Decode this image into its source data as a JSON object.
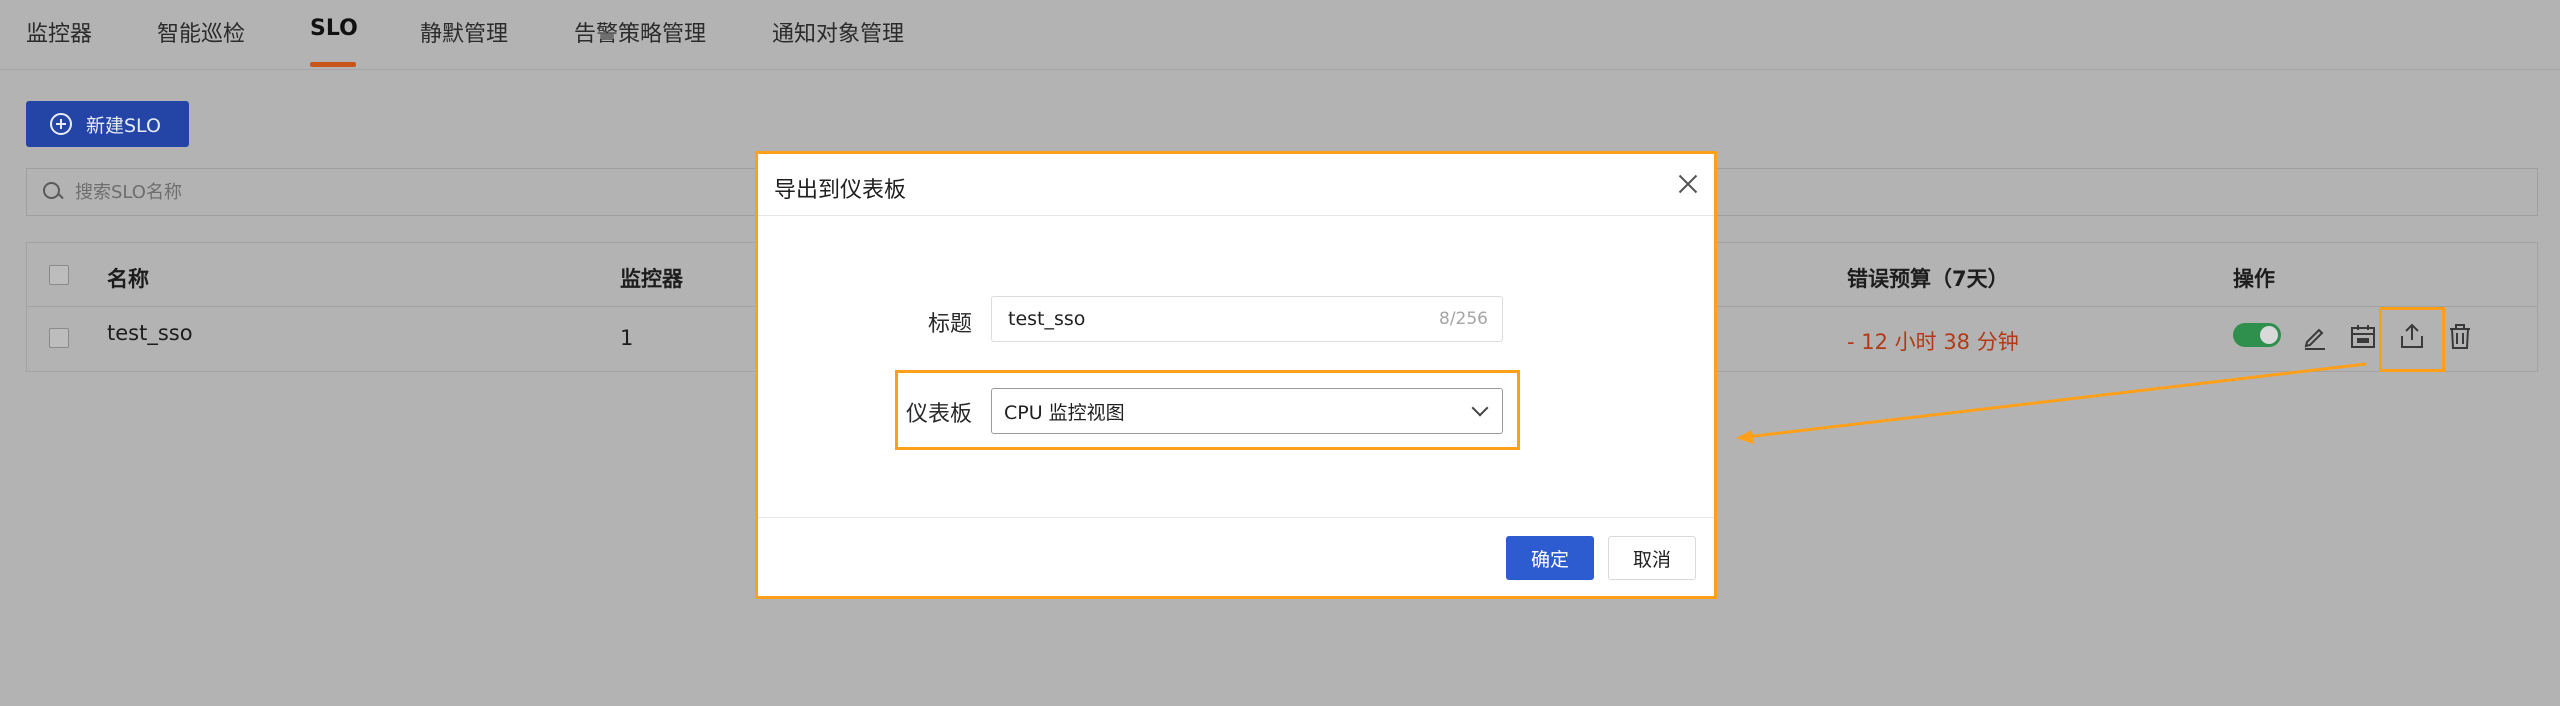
{
  "tabs": [
    {
      "label": "监控器"
    },
    {
      "label": "智能巡检"
    },
    {
      "label": "SLO",
      "active": true
    },
    {
      "label": "静默管理"
    },
    {
      "label": "告警策略管理"
    },
    {
      "label": "通知对象管理"
    }
  ],
  "toolbar": {
    "new_button_label": "新建SLO",
    "new_button_icon": "plus-circle-icon"
  },
  "search": {
    "placeholder": "搜索SLO名称",
    "value": ""
  },
  "table": {
    "columns": [
      "名称",
      "监控器",
      "错误预算（7天）",
      "操作"
    ],
    "rows": [
      {
        "name": "test_sso",
        "monitor": "1",
        "error_budget": "- 12 小时 38 分钟",
        "enabled": true
      }
    ],
    "actions": [
      "toggle",
      "edit-icon",
      "calendar-icon",
      "export-icon",
      "delete-icon"
    ]
  },
  "modal": {
    "title": "导出到仪表板",
    "fields": {
      "title_label": "标题",
      "title_value": "test_sso",
      "title_count": "8/256",
      "dashboard_label": "仪表板",
      "dashboard_value": "CPU 监控视图"
    },
    "ok_label": "确定",
    "cancel_label": "取消"
  },
  "colors": {
    "primary": "#2d5bd0",
    "highlight": "#ff9f1a",
    "error": "#b33a17",
    "toggle_on": "#2f8f4c",
    "tab_underline": "#c8561b"
  }
}
